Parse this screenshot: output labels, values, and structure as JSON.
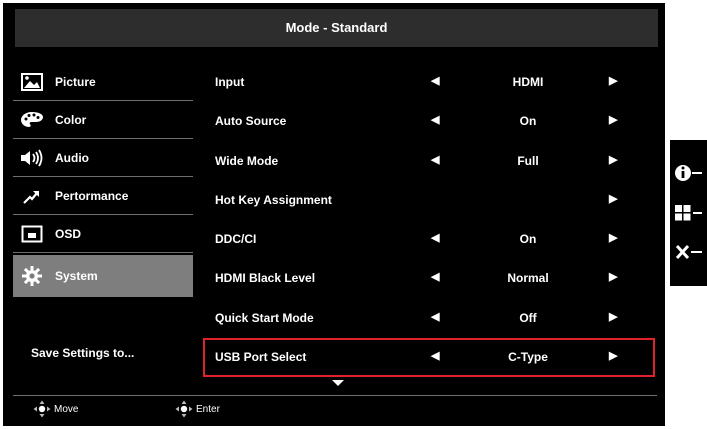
{
  "header": {
    "title": "Mode - Standard"
  },
  "sidebar": {
    "items": [
      {
        "label": "Picture",
        "icon": "picture-icon"
      },
      {
        "label": "Color",
        "icon": "palette-icon"
      },
      {
        "label": "Audio",
        "icon": "speaker-icon"
      },
      {
        "label": "Pertormance",
        "icon": "performance-arrow-icon"
      },
      {
        "label": "OSD",
        "icon": "osd-window-icon"
      },
      {
        "label": "System",
        "icon": "gear-icon",
        "active": true
      }
    ],
    "save_label": "Save Settings to..."
  },
  "settings": [
    {
      "label": "Input",
      "value": "HDMI",
      "left_arrow": "◀",
      "right_arrow": "▶"
    },
    {
      "label": "Auto Source",
      "value": "On",
      "left_arrow": "◀",
      "right_arrow": "▶"
    },
    {
      "label": "Wide Mode",
      "value": "Full",
      "left_arrow": "◀",
      "right_arrow": "▶"
    },
    {
      "label": "Hot Key Assignment",
      "value": "",
      "left_arrow": "",
      "right_arrow": "▶"
    },
    {
      "label": "DDC/CI",
      "value": "On",
      "left_arrow": "◀",
      "right_arrow": "▶"
    },
    {
      "label": "HDMI Black Level",
      "value": "Normal",
      "left_arrow": "◀",
      "right_arrow": "▶"
    },
    {
      "label": "Quick Start Mode",
      "value": "Off",
      "left_arrow": "◀",
      "right_arrow": "▶"
    },
    {
      "label": "USB Port Select",
      "value": "C-Type",
      "left_arrow": "◀",
      "right_arrow": "▶",
      "selected": true
    }
  ],
  "footer": {
    "move_label": "Move",
    "enter_label": "Enter"
  },
  "side_keys": [
    {
      "icon": "info-icon"
    },
    {
      "icon": "menu-grid-icon"
    },
    {
      "icon": "close-icon"
    }
  ],
  "colors": {
    "selection_outline": "#e0222a",
    "active_item_bg": "#7e7e7e",
    "header_bg": "#2d2d2d"
  }
}
